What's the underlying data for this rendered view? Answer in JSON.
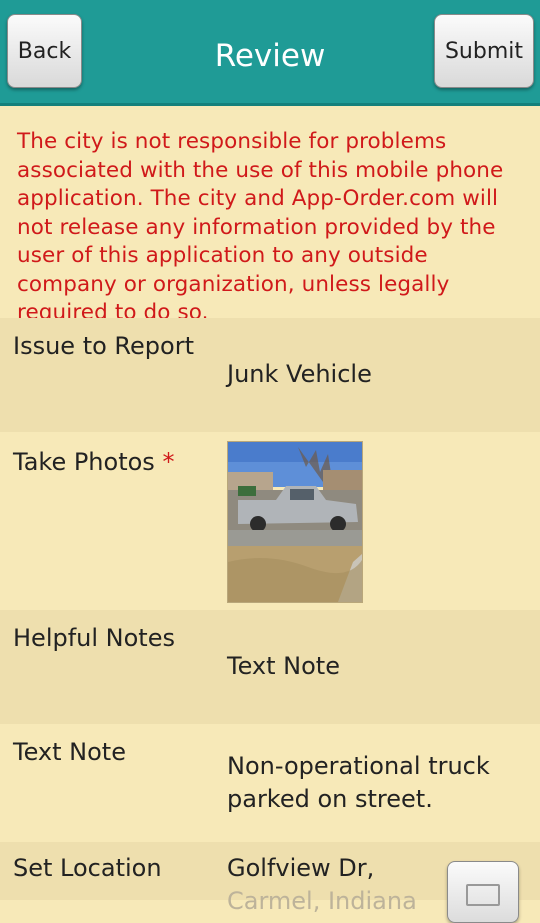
{
  "header": {
    "title": "Review",
    "back_label": "Back",
    "submit_label": "Submit"
  },
  "disclaimer": "The city is not responsible for problems associated with the use of this mobile phone application. The city and App-Order.com will not release any information provided by the user of this application to any outside company or organization, unless legally required to do so.",
  "fields": {
    "issue": {
      "label": "Issue to Report",
      "value": "Junk Vehicle"
    },
    "photos": {
      "label": "Take Photos",
      "required_mark": "*"
    },
    "notes": {
      "label": "Helpful Notes",
      "value": "Text Note"
    },
    "text_note": {
      "label": "Text Note",
      "value_line1": "Non-operational truck",
      "value_line2": "parked on street."
    },
    "location": {
      "label": "Set Location",
      "value_line1": "Golfview Dr,",
      "value_line2": "Carmel, Indiana"
    }
  },
  "colors": {
    "header": "#1f9b96",
    "background": "#f7e9b8",
    "row_alt": "#eedfae",
    "disclaimer_text": "#d0191a"
  },
  "icons": {
    "map": "map-icon"
  }
}
